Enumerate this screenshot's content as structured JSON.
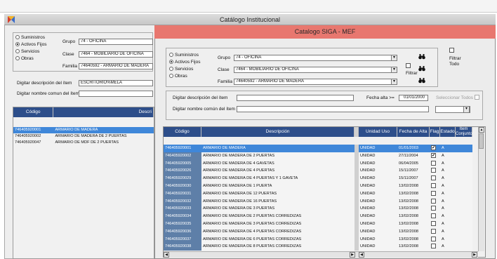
{
  "window": {
    "title": "Catálogo Institucional"
  },
  "dialog": {
    "title": "Catalogo SIGA - MEF"
  },
  "left_panel": {
    "radios": [
      {
        "label": "Suministros",
        "checked": false
      },
      {
        "label": "Activos Fijos",
        "checked": true
      },
      {
        "label": "Servicios",
        "checked": false
      },
      {
        "label": "Obras",
        "checked": false
      }
    ],
    "grupo_label": "Grupo",
    "grupo_value": "74 - OFICINA",
    "clase_label": "Clase",
    "clase_value": "7464 - MOBILIARIO DE OFICINA",
    "familia_label": "Familia",
    "familia_value": "74640592 - ARMARIO DE MADERA",
    "desc_label": "Digitar descripción del ítem",
    "desc_value": "ESCRITORIO%MELA",
    "nombre_label": "Digitar nombre comun del ítem",
    "nombre_value": "",
    "table": {
      "headers": [
        "Código",
        "Descri"
      ],
      "rows": [
        {
          "code": "746405920001",
          "desc": "ARMARIO DE MADERA",
          "selected": true
        },
        {
          "code": "746405920002",
          "desc": "ARMARIO DE MADERA DE 2 PUERTAS",
          "selected": false
        },
        {
          "code": "746405920047",
          "desc": "ARMARIO DE MDF DE 2 PUERTAS",
          "selected": false
        }
      ]
    }
  },
  "filters": {
    "radios": [
      {
        "label": "Suministros",
        "checked": false
      },
      {
        "label": "Activos Fijos",
        "checked": true
      },
      {
        "label": "Servicios",
        "checked": false
      },
      {
        "label": "Obras",
        "checked": false
      }
    ],
    "grupo_label": "Grupo",
    "grupo_value": "74 - OFICINA",
    "clase_label": "Clase",
    "clase_value": "7464 - MOBILIARIO DE OFICINA",
    "familia_label": "Familia",
    "familia_value": "74640592 - ARMARIO DE MADERA",
    "filtrar_label": "Filtrar",
    "filtrar_todo_label": "Filtrar Todo",
    "desc_label": "Digitar descripción del ítem",
    "nombre_label": "Digitar nombre común del ítem",
    "fecha_label": "Fecha alta  >=",
    "fecha_value": "01/01/2000",
    "select_all_label": "Seleccionar Todos"
  },
  "grid": {
    "headers": [
      "Código",
      "Descripción",
      "Unidad Uso",
      "Fecha de Alta",
      "Flag",
      "Estado",
      "Item Conjunto"
    ],
    "rows": [
      {
        "code": "746405920001",
        "desc": "ARMARIO DE MADERA",
        "unit": "UNIDAD",
        "date": "01/01/2003",
        "flag": true,
        "estado": "A",
        "selected": true
      },
      {
        "code": "746405920002",
        "desc": "ARMARIO DE MADERA DE 2 PUERTAS",
        "unit": "UNIDAD",
        "date": "27/11/2004",
        "flag": true,
        "estado": "A",
        "selected": false
      },
      {
        "code": "746405920005",
        "desc": "ARMARIO DE MADERA DE 4 GAVETAS",
        "unit": "UNIDAD",
        "date": "06/04/2005",
        "flag": false,
        "estado": "A",
        "selected": false
      },
      {
        "code": "746405920026",
        "desc": "ARMARIO DE MADERA DE 4 PUERTAS",
        "unit": "UNIDAD",
        "date": "15/11/2007",
        "flag": false,
        "estado": "A",
        "selected": false
      },
      {
        "code": "746405920029",
        "desc": "ARMARIO DE MADERA DE 4 PUERTAS Y 1 GAVETA",
        "unit": "UNIDAD",
        "date": "15/11/2007",
        "flag": false,
        "estado": "A",
        "selected": false
      },
      {
        "code": "746405920030",
        "desc": "ARMARIO DE MADERA DE 1 PUERTA",
        "unit": "UNIDAD",
        "date": "13/02/2008",
        "flag": false,
        "estado": "A",
        "selected": false
      },
      {
        "code": "746405920031",
        "desc": "ARMARIO DE MADERA DE 12 PUERTAS",
        "unit": "UNIDAD",
        "date": "13/02/2008",
        "flag": false,
        "estado": "A",
        "selected": false
      },
      {
        "code": "746405920032",
        "desc": "ARMARIO DE MADERA DE 16 PUERTAS",
        "unit": "UNIDAD",
        "date": "13/02/2008",
        "flag": false,
        "estado": "A",
        "selected": false
      },
      {
        "code": "746405920033",
        "desc": "ARMARIO DE MADERA DE 3 PUERTAS",
        "unit": "UNIDAD",
        "date": "13/02/2008",
        "flag": false,
        "estado": "A",
        "selected": false
      },
      {
        "code": "746405920034",
        "desc": "ARMARIO DE MADERA DE 2 PUERTAS CORREDIZAS",
        "unit": "UNIDAD",
        "date": "13/02/2008",
        "flag": false,
        "estado": "A",
        "selected": false
      },
      {
        "code": "746405920035",
        "desc": "ARMARIO DE MADERA DE 3 PUERTAS CORREDIZAS",
        "unit": "UNIDAD",
        "date": "13/02/2008",
        "flag": false,
        "estado": "A",
        "selected": false
      },
      {
        "code": "746405920036",
        "desc": "ARMARIO DE MADERA DE 4 PUERTAS CORREDIZAS",
        "unit": "UNIDAD",
        "date": "13/02/2008",
        "flag": false,
        "estado": "A",
        "selected": false
      },
      {
        "code": "746405920037",
        "desc": "ARMARIO DE MADERA DE 6 PUERTAS CORREDIZAS",
        "unit": "UNIDAD",
        "date": "13/02/2008",
        "flag": false,
        "estado": "A",
        "selected": false
      },
      {
        "code": "746405920038",
        "desc": "ARMARIO DE MADERA DE 8 PUERTAS CORREDIZAS",
        "unit": "UNIDAD",
        "date": "13/02/2008",
        "flag": false,
        "estado": "A",
        "selected": false
      }
    ]
  },
  "icons": {
    "app": "app-logo-icon",
    "binoculars": "binoculars-icon"
  },
  "colors": {
    "dialog_title_bg": "#e8776f",
    "grid_header_bg": "#2d4e8a",
    "selected_row_bg": "#3f87d9",
    "code_cell_bg": "#5e7fa8"
  }
}
